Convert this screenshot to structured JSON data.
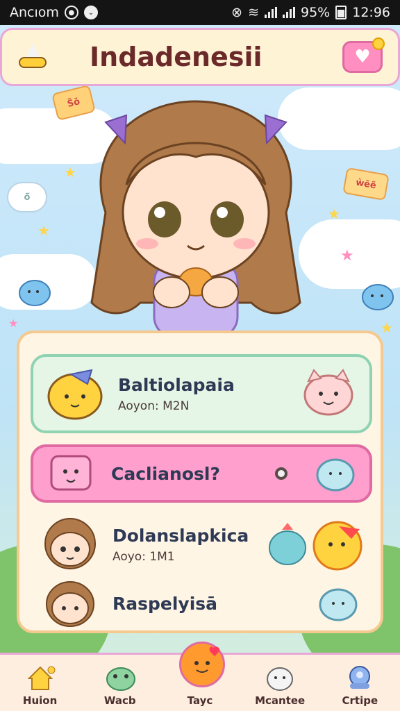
{
  "status_bar": {
    "left_text": "Ancıom",
    "signal_icons": [
      "target-icon",
      "chevron-icon"
    ],
    "right_icons": [
      "mute-icon",
      "wifi-icon",
      "signal-icon"
    ],
    "battery": "95%",
    "time": "12:96"
  },
  "header": {
    "title": "Indadenesii",
    "left_icon": "witch-hat-icon",
    "right_icon": "heart-message-icon"
  },
  "stickers": {
    "top_left": "S̃ǒ",
    "right": "ẁẽẽ",
    "bubble": "ö̃"
  },
  "list": {
    "item1": {
      "title": "Baltiolapaia",
      "subtitle": "Aoyon: M2N"
    },
    "item2": {
      "title": "Caclianosl?"
    },
    "item3": {
      "title": "Dolanslapkica",
      "subtitle": "Aoyo: 1M1"
    },
    "item4": {
      "title": "Raspelyisā"
    }
  },
  "nav": {
    "items": [
      {
        "label": "Huion",
        "icon": "house-icon"
      },
      {
        "label": "Wacb",
        "icon": "frog-icon"
      },
      {
        "label": "Tayc",
        "icon": "orb-icon"
      },
      {
        "label": "Mcantee",
        "icon": "ghost-icon"
      },
      {
        "label": "Crtipe",
        "icon": "robot-icon"
      }
    ]
  },
  "colors": {
    "accent_pink": "#ff9fcd",
    "card_green": "#e6f6e6",
    "title_brown": "#6b2a2a"
  }
}
